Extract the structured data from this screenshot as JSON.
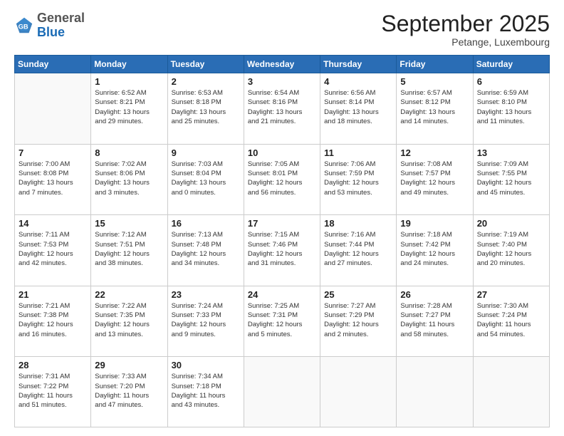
{
  "logo": {
    "general": "General",
    "blue": "Blue"
  },
  "header": {
    "month": "September 2025",
    "location": "Petange, Luxembourg"
  },
  "days_of_week": [
    "Sunday",
    "Monday",
    "Tuesday",
    "Wednesday",
    "Thursday",
    "Friday",
    "Saturday"
  ],
  "weeks": [
    [
      {
        "day": "",
        "info": ""
      },
      {
        "day": "1",
        "info": "Sunrise: 6:52 AM\nSunset: 8:21 PM\nDaylight: 13 hours\nand 29 minutes."
      },
      {
        "day": "2",
        "info": "Sunrise: 6:53 AM\nSunset: 8:18 PM\nDaylight: 13 hours\nand 25 minutes."
      },
      {
        "day": "3",
        "info": "Sunrise: 6:54 AM\nSunset: 8:16 PM\nDaylight: 13 hours\nand 21 minutes."
      },
      {
        "day": "4",
        "info": "Sunrise: 6:56 AM\nSunset: 8:14 PM\nDaylight: 13 hours\nand 18 minutes."
      },
      {
        "day": "5",
        "info": "Sunrise: 6:57 AM\nSunset: 8:12 PM\nDaylight: 13 hours\nand 14 minutes."
      },
      {
        "day": "6",
        "info": "Sunrise: 6:59 AM\nSunset: 8:10 PM\nDaylight: 13 hours\nand 11 minutes."
      }
    ],
    [
      {
        "day": "7",
        "info": "Sunrise: 7:00 AM\nSunset: 8:08 PM\nDaylight: 13 hours\nand 7 minutes."
      },
      {
        "day": "8",
        "info": "Sunrise: 7:02 AM\nSunset: 8:06 PM\nDaylight: 13 hours\nand 3 minutes."
      },
      {
        "day": "9",
        "info": "Sunrise: 7:03 AM\nSunset: 8:04 PM\nDaylight: 13 hours\nand 0 minutes."
      },
      {
        "day": "10",
        "info": "Sunrise: 7:05 AM\nSunset: 8:01 PM\nDaylight: 12 hours\nand 56 minutes."
      },
      {
        "day": "11",
        "info": "Sunrise: 7:06 AM\nSunset: 7:59 PM\nDaylight: 12 hours\nand 53 minutes."
      },
      {
        "day": "12",
        "info": "Sunrise: 7:08 AM\nSunset: 7:57 PM\nDaylight: 12 hours\nand 49 minutes."
      },
      {
        "day": "13",
        "info": "Sunrise: 7:09 AM\nSunset: 7:55 PM\nDaylight: 12 hours\nand 45 minutes."
      }
    ],
    [
      {
        "day": "14",
        "info": "Sunrise: 7:11 AM\nSunset: 7:53 PM\nDaylight: 12 hours\nand 42 minutes."
      },
      {
        "day": "15",
        "info": "Sunrise: 7:12 AM\nSunset: 7:51 PM\nDaylight: 12 hours\nand 38 minutes."
      },
      {
        "day": "16",
        "info": "Sunrise: 7:13 AM\nSunset: 7:48 PM\nDaylight: 12 hours\nand 34 minutes."
      },
      {
        "day": "17",
        "info": "Sunrise: 7:15 AM\nSunset: 7:46 PM\nDaylight: 12 hours\nand 31 minutes."
      },
      {
        "day": "18",
        "info": "Sunrise: 7:16 AM\nSunset: 7:44 PM\nDaylight: 12 hours\nand 27 minutes."
      },
      {
        "day": "19",
        "info": "Sunrise: 7:18 AM\nSunset: 7:42 PM\nDaylight: 12 hours\nand 24 minutes."
      },
      {
        "day": "20",
        "info": "Sunrise: 7:19 AM\nSunset: 7:40 PM\nDaylight: 12 hours\nand 20 minutes."
      }
    ],
    [
      {
        "day": "21",
        "info": "Sunrise: 7:21 AM\nSunset: 7:38 PM\nDaylight: 12 hours\nand 16 minutes."
      },
      {
        "day": "22",
        "info": "Sunrise: 7:22 AM\nSunset: 7:35 PM\nDaylight: 12 hours\nand 13 minutes."
      },
      {
        "day": "23",
        "info": "Sunrise: 7:24 AM\nSunset: 7:33 PM\nDaylight: 12 hours\nand 9 minutes."
      },
      {
        "day": "24",
        "info": "Sunrise: 7:25 AM\nSunset: 7:31 PM\nDaylight: 12 hours\nand 5 minutes."
      },
      {
        "day": "25",
        "info": "Sunrise: 7:27 AM\nSunset: 7:29 PM\nDaylight: 12 hours\nand 2 minutes."
      },
      {
        "day": "26",
        "info": "Sunrise: 7:28 AM\nSunset: 7:27 PM\nDaylight: 11 hours\nand 58 minutes."
      },
      {
        "day": "27",
        "info": "Sunrise: 7:30 AM\nSunset: 7:24 PM\nDaylight: 11 hours\nand 54 minutes."
      }
    ],
    [
      {
        "day": "28",
        "info": "Sunrise: 7:31 AM\nSunset: 7:22 PM\nDaylight: 11 hours\nand 51 minutes."
      },
      {
        "day": "29",
        "info": "Sunrise: 7:33 AM\nSunset: 7:20 PM\nDaylight: 11 hours\nand 47 minutes."
      },
      {
        "day": "30",
        "info": "Sunrise: 7:34 AM\nSunset: 7:18 PM\nDaylight: 11 hours\nand 43 minutes."
      },
      {
        "day": "",
        "info": ""
      },
      {
        "day": "",
        "info": ""
      },
      {
        "day": "",
        "info": ""
      },
      {
        "day": "",
        "info": ""
      }
    ]
  ]
}
